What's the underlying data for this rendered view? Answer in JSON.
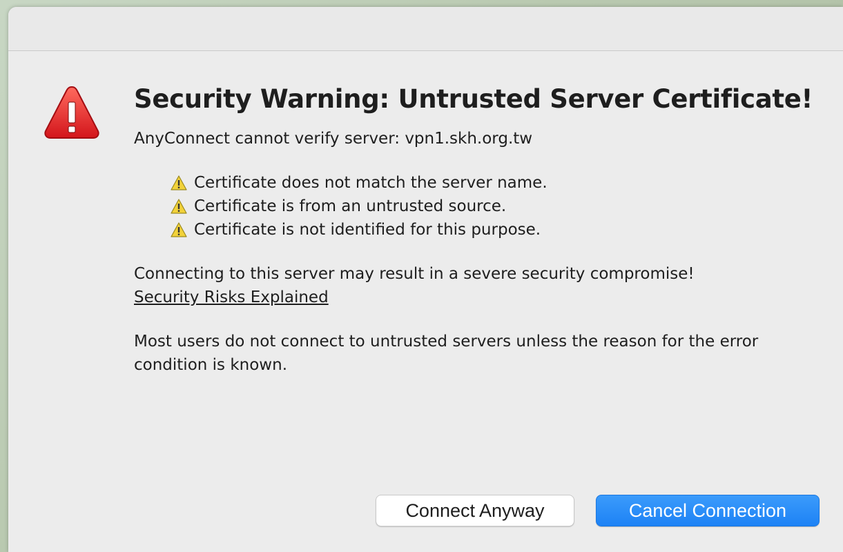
{
  "dialog": {
    "title": "Security Warning: Untrusted Server Certificate!",
    "server_message": "AnyConnect cannot verify server: vpn1.skh.org.tw",
    "issues": [
      {
        "icon": "small-warning-icon",
        "text": "Certificate does not match the server name."
      },
      {
        "icon": "small-warning-icon",
        "text": "Certificate is from an untrusted source."
      },
      {
        "icon": "small-warning-icon",
        "text": "Certificate is not identified for this purpose."
      }
    ],
    "risk_message": "Connecting to this server may result in a severe security compromise!",
    "risk_link": "Security Risks Explained",
    "advice_message": "Most users do not connect to untrusted servers unless the reason for the error condition is known.",
    "buttons": {
      "connect_anyway": "Connect Anyway",
      "cancel_connection": "Cancel Connection"
    },
    "colors": {
      "warning_red": "#e0252a",
      "primary_blue": "#1d82f5",
      "small_warning_yellow": "#f2d23a"
    },
    "main_icon": "warning-triangle-icon"
  }
}
